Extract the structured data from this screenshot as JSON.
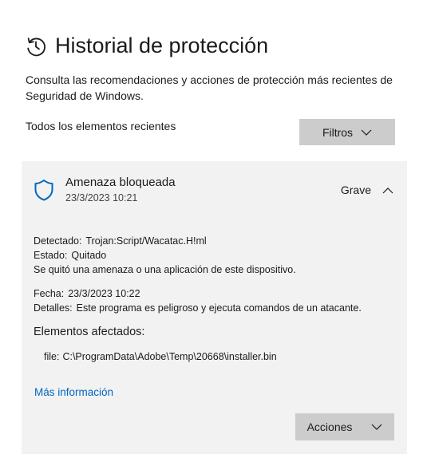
{
  "header": {
    "icon": "history-icon",
    "title": "Historial de protección"
  },
  "description": "Consulta las recomendaciones y acciones de protección más recientes de Seguridad de Windows.",
  "filter_bar": {
    "label": "Todos los elementos recientes",
    "filter_button_label": "Filtros"
  },
  "threat_card": {
    "icon": "shield-icon",
    "title": "Amenaza bloqueada",
    "date": "23/3/2023 10:21",
    "severity": "Grave",
    "details": {
      "detected_label": "Detectado:",
      "detected_value": "Trojan:Script/Wacatac.H!ml",
      "status_label": "Estado:",
      "status_value": "Quitado",
      "status_message": "Se quitó una amenaza o una aplicación de este dispositivo.",
      "date_label": "Fecha:",
      "date_value": "23/3/2023 10:22",
      "details_label": "Detalles:",
      "details_value": "Este programa es peligroso y ejecuta comandos de un atacante."
    },
    "affected_items_heading": "Elementos afectados:",
    "affected_file_label": "file:",
    "affected_file_path": "C:\\ProgramData\\Adobe\\Temp\\20668\\installer.bin",
    "more_info_link": "Más información",
    "actions_button_label": "Acciones"
  },
  "colors": {
    "accent": "#0067c0",
    "button_bg": "#cccccc",
    "card_bg": "#f2f2f2",
    "text": "#1b1b1b"
  }
}
